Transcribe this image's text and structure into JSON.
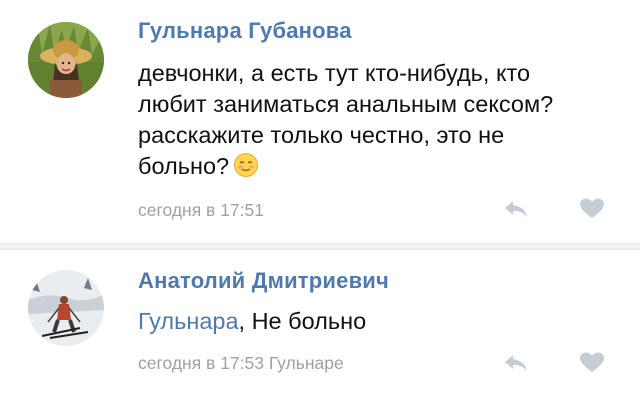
{
  "comments": [
    {
      "author": "Гульнара Губанова",
      "text": "девчонки, а есть тут кто-нибудь, кто любит заниматься анальным сексом? расскажите только честно, это не больно?",
      "emoji_icon": "smiling-face-emoji",
      "time": "сегодня в 17:51",
      "avatar_icon": "woman-in-straw-hat-avatar"
    },
    {
      "author": "Анатолий Дмитриевич",
      "reply_to": "Гульнара",
      "text_after_mention": ", Не больно",
      "time": "сегодня в 17:53 Гульнаре",
      "avatar_icon": "skier-avatar"
    }
  ],
  "icons": {
    "reply": "reply-arrow-icon",
    "like": "heart-icon"
  },
  "colors": {
    "author": "#4f7ab0",
    "text": "#111111",
    "meta": "#9aa2ac",
    "icon": "#c5ccd4",
    "separator": "#f0f2f5"
  }
}
